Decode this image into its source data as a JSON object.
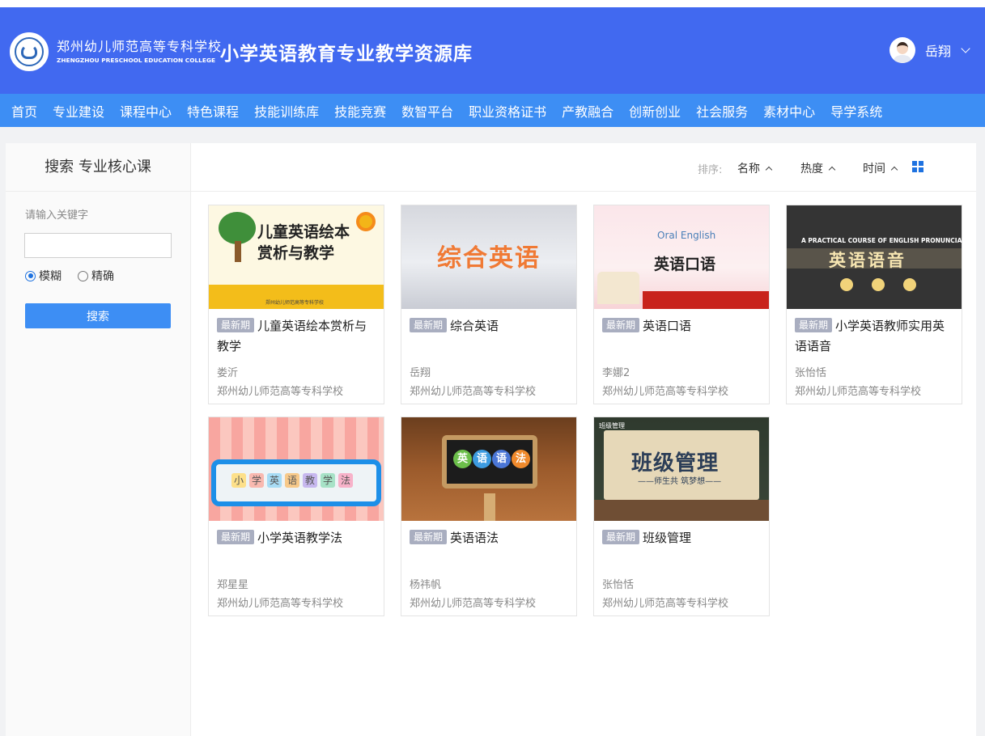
{
  "header": {
    "school_cn": "郑州幼儿师范高等专科学校",
    "school_en": "ZHENGZHOU PRESCHOOL EDUCATION COLLEGE",
    "site_title": "小学英语教育专业教学资源库",
    "user_name": "岳翔"
  },
  "nav": {
    "items": [
      "首页",
      "专业建设",
      "课程中心",
      "特色课程",
      "技能训练库",
      "技能竞赛",
      "数智平台",
      "职业资格证书",
      "产教融合",
      "创新创业",
      "社会服务",
      "素材中心",
      "导学系统"
    ]
  },
  "sidebar": {
    "title": "搜索 专业核心课",
    "keyword_label": "请输入关键字",
    "keyword_value": "",
    "radio_fuzzy": "模糊",
    "radio_exact": "精确",
    "search_button": "搜索"
  },
  "sortbar": {
    "label": "排序:",
    "by_name": "名称",
    "by_heat": "热度",
    "by_time": "时间"
  },
  "cards": [
    {
      "badge": "最新期",
      "title": "儿童英语绘本赏析与教学",
      "author": "娄沂",
      "school": "郑州幼儿师范高等专科学校",
      "thumb_text": "儿童英语绘本赏析与教学",
      "thumb_small": "郑州幼儿师范高等专科学校"
    },
    {
      "badge": "最新期",
      "title": "综合英语",
      "author": "岳翔",
      "school": "郑州幼儿师范高等专科学校",
      "thumb_text": "综合英语"
    },
    {
      "badge": "最新期",
      "title": "英语口语",
      "author": "李娜2",
      "school": "郑州幼儿师范高等专科学校",
      "thumb_en": "Oral English",
      "thumb_text": "英语口语"
    },
    {
      "badge": "最新期",
      "title": "小学英语教师实用英语语音",
      "author": "张怡恬",
      "school": "郑州幼儿师范高等专科学校",
      "thumb_en": "A PRACTICAL COURSE OF ENGLISH PRONUNCIATION",
      "thumb_text": "英语语音"
    },
    {
      "badge": "最新期",
      "title": "小学英语教学法",
      "author": "郑星星",
      "school": "郑州幼儿师范高等专科学校",
      "thumb_chars": [
        "小",
        "学",
        "英",
        "语",
        "教",
        "学",
        "法"
      ]
    },
    {
      "badge": "最新期",
      "title": "英语语法",
      "author": "杨祎帆",
      "school": "郑州幼儿师范高等专科学校",
      "thumb_chars": [
        "英",
        "语",
        "语",
        "法"
      ]
    },
    {
      "badge": "最新期",
      "title": "班级管理",
      "author": "张怡恬",
      "school": "郑州幼儿师范高等专科学校",
      "thumb_top": "班级管理",
      "thumb_text": "班级管理",
      "thumb_sub": "——师生共 筑梦想——"
    }
  ],
  "colors": {
    "header_bg": "#4169f0",
    "nav_bg": "#3d8ef4",
    "accent": "#1e72e0",
    "badge_bg": "#a9aec0"
  }
}
